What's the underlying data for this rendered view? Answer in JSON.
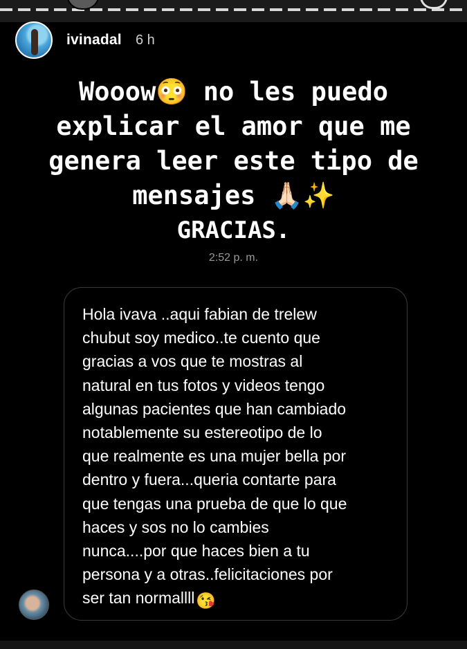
{
  "story": {
    "username": "ivinadal",
    "time_ago": "6 h",
    "text_lines": [
      "Wooow😳 no les puedo",
      "explicar el amor que me",
      "genera leer este tipo de",
      "mensajes 🙏🏻✨",
      "GRACIAS."
    ]
  },
  "message": {
    "timestamp": "2:52 p. m.",
    "lines": [
      "Hola ivava ..aqui fabian de trelew",
      "chubut soy medico..te cuento que",
      "gracias a vos que te mostras al",
      "natural en tus fotos y videos tengo",
      "algunas pacientes que han cambiado",
      "notablemente su estereotipo de lo",
      "que realmente es una mujer bella por",
      "dentro y fuera...queria contarte para",
      "que tengas una prueba de que lo que",
      "haces y sos no lo cambies",
      "nunca....por que haces bien a tu",
      "persona y a otras..felicitaciones por",
      "ser tan normallll"
    ],
    "end_emoji": "😘"
  },
  "icons": {
    "header_avatar": "profile-photo-icon",
    "sender_avatar": "sender-profile-photo-icon"
  },
  "colors": {
    "background": "#000000",
    "text": "#ffffff",
    "muted": "#9a9a9a",
    "bubble_border": "#3a3a3a"
  }
}
